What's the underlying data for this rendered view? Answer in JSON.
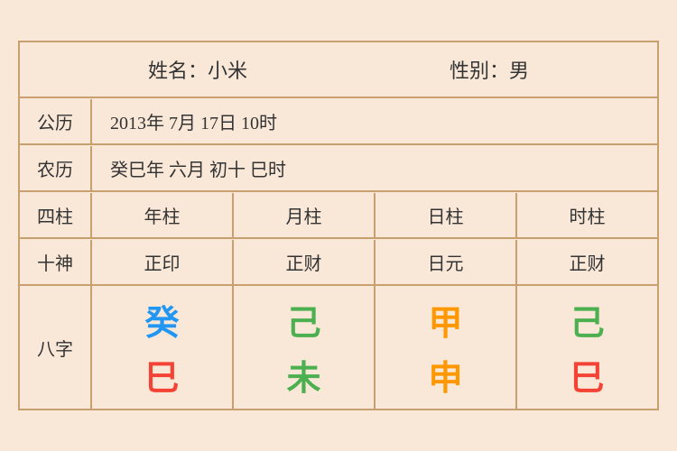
{
  "header": {
    "name_label": "姓名：小米",
    "gender_label": "性别：男"
  },
  "rows": {
    "gregorian_label": "公历",
    "gregorian_value": "2013年 7月 17日 10时",
    "lunar_label": "农历",
    "lunar_value": "癸巳年 六月 初十 巳时"
  },
  "four_pillars": {
    "label": "四柱",
    "columns": [
      "年柱",
      "月柱",
      "日柱",
      "时柱"
    ]
  },
  "ten_gods": {
    "label": "十神",
    "columns": [
      "正印",
      "正财",
      "日元",
      "正财"
    ]
  },
  "bazhi": {
    "label": "八字",
    "columns": [
      {
        "top": "癸",
        "bottom": "巳",
        "top_color": "#2196F3",
        "bottom_color": "#F44336"
      },
      {
        "top": "己",
        "bottom": "未",
        "top_color": "#4CAF50",
        "bottom_color": "#4CAF50"
      },
      {
        "top": "甲",
        "bottom": "申",
        "top_color": "#FF9800",
        "bottom_color": "#FF9800"
      },
      {
        "top": "己",
        "bottom": "巳",
        "top_color": "#4CAF50",
        "bottom_color": "#F44336"
      }
    ]
  }
}
